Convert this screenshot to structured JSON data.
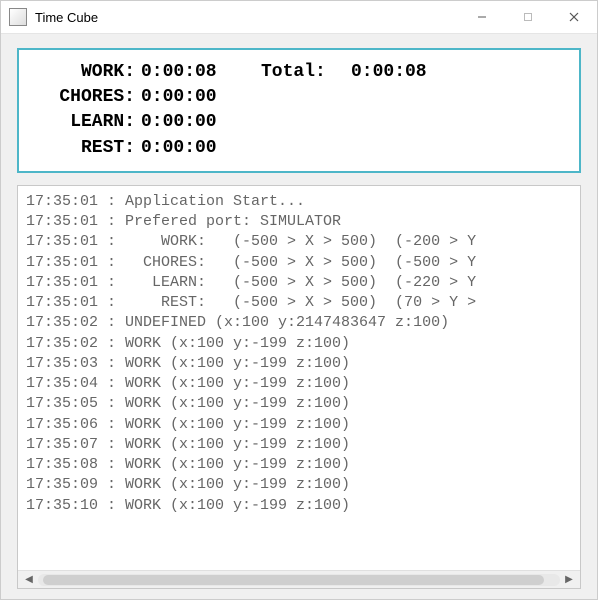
{
  "window": {
    "title": "Time Cube"
  },
  "summary": {
    "work": {
      "label": "WORK:",
      "time": "0:00:08"
    },
    "chores": {
      "label": "CHORES:",
      "time": "0:00:00"
    },
    "learn": {
      "label": "LEARN:",
      "time": "0:00:00"
    },
    "rest": {
      "label": "REST:",
      "time": "0:00:00"
    },
    "total_label": "Total:",
    "total_time": "0:00:08"
  },
  "log": {
    "lines": [
      "17:35:01 : Application Start...",
      "17:35:01 : Prefered port: SIMULATOR",
      "17:35:01 :     WORK:   (-500 > X > 500)  (-200 > Y",
      "17:35:01 :   CHORES:   (-500 > X > 500)  (-500 > Y",
      "17:35:01 :    LEARN:   (-500 > X > 500)  (-220 > Y",
      "17:35:01 :     REST:   (-500 > X > 500)  (70 > Y >",
      "17:35:02 : UNDEFINED (x:100 y:2147483647 z:100)",
      "17:35:02 : WORK (x:100 y:-199 z:100)",
      "17:35:03 : WORK (x:100 y:-199 z:100)",
      "17:35:04 : WORK (x:100 y:-199 z:100)",
      "17:35:05 : WORK (x:100 y:-199 z:100)",
      "17:35:06 : WORK (x:100 y:-199 z:100)",
      "17:35:07 : WORK (x:100 y:-199 z:100)",
      "17:35:08 : WORK (x:100 y:-199 z:100)",
      "17:35:09 : WORK (x:100 y:-199 z:100)",
      "17:35:10 : WORK (x:100 y:-199 z:100)"
    ]
  }
}
